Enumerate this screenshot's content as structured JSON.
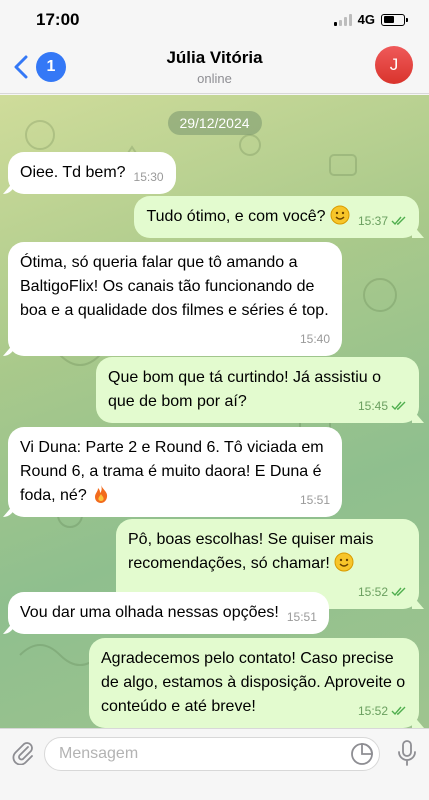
{
  "status_bar": {
    "time": "17:00",
    "network": "4G",
    "battery_level": 0.55
  },
  "header": {
    "back_count": "1",
    "contact_name": "Júlia Vitória",
    "contact_status": "online",
    "avatar_initial": "J"
  },
  "chat": {
    "date": "29/12/2024",
    "messages": [
      {
        "direction": "incoming",
        "text": "Oiee. Td bem?",
        "time": "15:30"
      },
      {
        "direction": "outgoing",
        "text": "Tudo ótimo, e com você?",
        "emoji": "smiling-face",
        "time": "15:37",
        "read": true
      },
      {
        "direction": "incoming",
        "text": "Ótima, só queria falar que tô amando a BaltigoFlix! Os canais tão funcionando de boa e a qualidade dos filmes e séries é top.",
        "time": "15:40"
      },
      {
        "direction": "outgoing",
        "text": "Que bom que tá curtindo! Já assistiu o que de bom por aí?",
        "time": "15:45",
        "read": true
      },
      {
        "direction": "incoming",
        "text": "Vi Duna: Parte 2 e Round 6. Tô viciada em Round 6, a trama é muito daora! E Duna é foda, né?",
        "emoji": "fire",
        "time": "15:51"
      },
      {
        "direction": "outgoing",
        "text": "Pô, boas escolhas! Se quiser mais recomendações, só chamar!",
        "emoji": "smiling-face",
        "time": "15:52",
        "read": true
      },
      {
        "direction": "incoming",
        "text": "Vou dar uma olhada nessas opções!",
        "time": "15:51"
      },
      {
        "direction": "outgoing",
        "text": "Agradecemos pelo contato! Caso precise de algo, estamos à disposição. Aproveite o conteúdo e até breve!",
        "time": "15:52",
        "read": true
      }
    ]
  },
  "input": {
    "placeholder": "Mensagem"
  },
  "colors": {
    "accent": "#3478f6",
    "outgoing_bubble": "#e3fbcf",
    "incoming_bubble": "#ffffff",
    "read_ticks": "#4fae4e"
  }
}
